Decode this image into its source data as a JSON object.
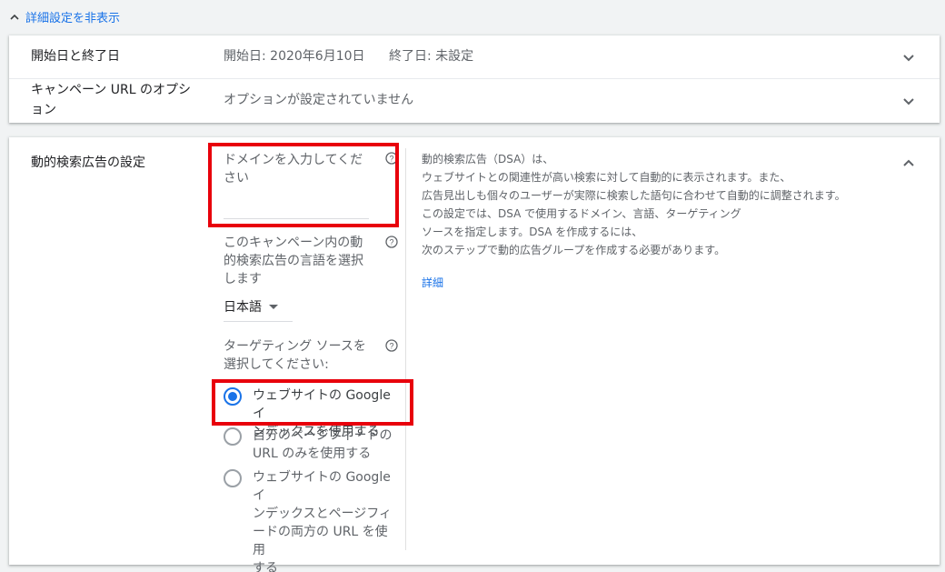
{
  "toggle": {
    "label": "詳細設定を非表示"
  },
  "rows": [
    {
      "label": "開始日と終了日",
      "value_start": "開始日: 2020年6月10日",
      "value_end": "終了日: 未設定"
    },
    {
      "label_line1": "キャンペーン URL のオプシ",
      "label_line2": "ョン",
      "value": "オプションが設定されていません"
    }
  ],
  "dsa": {
    "title": "動的検索広告の設定",
    "domain_placeholder_line1": "ドメインを入力してくだ",
    "domain_placeholder_line2": "さい",
    "language_label_line1": "このキャンペーン内の動",
    "language_label_line2": "的検索広告の言語を選択",
    "language_label_line3": "します",
    "language_value": "日本語",
    "targeting_label_line1": "ターゲティング ソースを",
    "targeting_label_line2": "選択してください:",
    "options": [
      {
        "line1": "ウェブサイトの Google イ",
        "line2": "ンデックスを使用する",
        "line3": "",
        "line4": "",
        "selected": true
      },
      {
        "line1": "自分のページフィードの",
        "line2": "URL のみを使用する",
        "line3": "",
        "line4": "",
        "selected": false
      },
      {
        "line1": "ウェブサイトの Google イ",
        "line2": "ンデックスとページフィ",
        "line3": "ードの両方の URL を使用",
        "line4": "する",
        "selected": false
      }
    ],
    "description": [
      "動的検索広告（DSA）は、",
      "ウェブサイトとの関連性が高い検索に対して自動的に表示されます。また、",
      "広告見出しも個々のユーザーが実際に検索した語句に合わせて自動的に調整されます。",
      "この設定では、DSA で使用するドメイン、言語、ターゲティング",
      "ソースを指定します。DSA を作成するには、",
      "次のステップで動的広告グループを作成する必要があります。"
    ],
    "more_link": "詳細"
  },
  "colors": {
    "accent": "#1a73e8",
    "highlight": "#e8000b"
  },
  "icons": [
    "chevron-up-icon",
    "chevron-down-icon",
    "help-icon",
    "radio-icon"
  ]
}
